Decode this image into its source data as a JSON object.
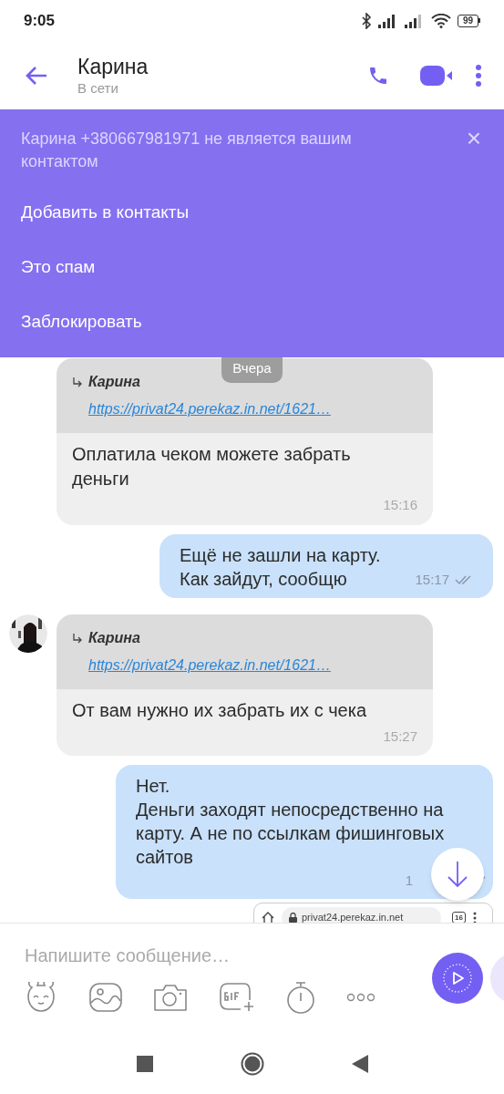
{
  "status_bar": {
    "time": "9:05",
    "battery": "99"
  },
  "header": {
    "name": "Карина",
    "presence": "В сети"
  },
  "banner": {
    "notice": "Карина +380667981971 не является вашим контактом",
    "close": "×",
    "actions": [
      "Добавить в контакты",
      "Это спам",
      "Заблокировать"
    ]
  },
  "date_chip": "Вчера",
  "messages": [
    {
      "kind": "incoming",
      "avatar": false,
      "quote": {
        "author": "Карина",
        "link": "https://privat24.perekaz.in.net/1621…"
      },
      "text": "Оплатила чеком можете забрать деньги",
      "time": "15:16"
    },
    {
      "kind": "outgoing",
      "text": "Ещё не зашли на карту.\nКак зайдут, сообщю",
      "time": "15:17",
      "seen": false
    },
    {
      "kind": "incoming",
      "avatar": true,
      "quote": {
        "author": "Карина",
        "link": "https://privat24.perekaz.in.net/1621…"
      },
      "text": "От вам нужно их забрать их с чека",
      "time": "15:27"
    },
    {
      "kind": "outgoing",
      "text": "Нет.\nДеньги заходят непосредственно на карту. А не по ссылкам фишинговых сайтов",
      "time": "1",
      "seen": false
    }
  ],
  "shared_image": {
    "url": "privat24.perekaz.in.net",
    "tab_count": "16"
  },
  "composer": {
    "placeholder": "Напишите сообщение…"
  }
}
